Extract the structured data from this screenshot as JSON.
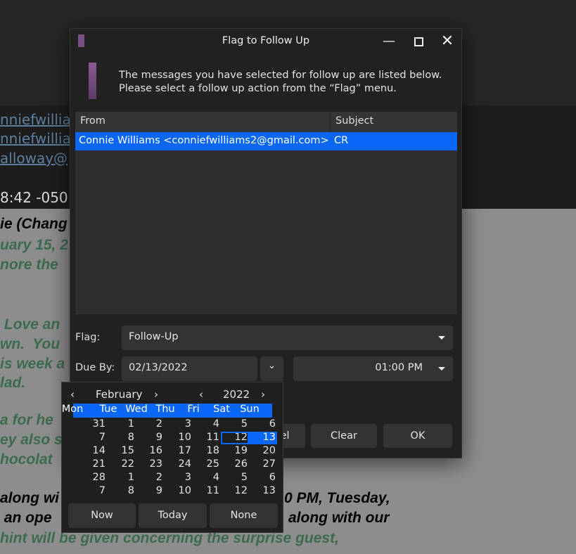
{
  "background": {
    "links": [
      "nniefwillia",
      "nniefwillia",
      "alloway@"
    ],
    "date_fragment": "8:42 -050",
    "lines": [
      {
        "left": "ie (Chang",
        "right": "",
        "style": "black"
      },
      {
        "left": "uary 15, 2",
        "right": "",
        "style": "green"
      },
      {
        "left": "nore the",
        "right": "",
        "style": "green"
      },
      {
        "left": " Love an",
        "right": "",
        "style": "green"
      },
      {
        "left": "wn.  You",
        "right": "",
        "style": "green"
      },
      {
        "left": "is week a",
        "right": "",
        "style": "green"
      },
      {
        "left": "lad.",
        "right": "",
        "style": "green"
      },
      {
        "left": "a for he",
        "right": "",
        "style": "green"
      },
      {
        "left": "ey also s",
        "right": "",
        "style": "green"
      },
      {
        "left": "hocolat",
        "right": "",
        "style": "green"
      },
      {
        "left": "along wi",
        "right": "0 PM, Tuesday,",
        "style": "black"
      },
      {
        "left": " an ope",
        "right": "along with our",
        "style": "black"
      },
      {
        "left": "hint will be given concerning the surprise guest,",
        "right": "",
        "style": "green"
      }
    ]
  },
  "dialog": {
    "title": "Flag to Follow Up",
    "message_line1": "The messages you have selected for follow up are listed below.",
    "message_line2": "Please select a follow up action from the “Flag” menu.",
    "columns": [
      "From",
      "Subject"
    ],
    "rows": [
      {
        "from": "Connie Williams <conniefwilliams2@gmail.com>",
        "subject": "CR"
      }
    ],
    "flag_label": "Flag:",
    "flag_value": "Follow-Up",
    "due_label": "Due By:",
    "due_date": "02/13/2022",
    "due_time": "01:00 PM",
    "buttons": {
      "cancel": "Cancel",
      "clear": "Clear",
      "ok": "OK"
    },
    "accent": "#0a66f5"
  },
  "calendar": {
    "month": "February",
    "year": "2022",
    "weekdays": [
      "Mon",
      "Tue",
      "Wed",
      "Thu",
      "Fri",
      "Sat",
      "Sun"
    ],
    "weeks": [
      [
        "31",
        "1",
        "2",
        "3",
        "4",
        "5",
        "6"
      ],
      [
        "7",
        "8",
        "9",
        "10",
        "11",
        "12",
        "13"
      ],
      [
        "14",
        "15",
        "16",
        "17",
        "18",
        "19",
        "20"
      ],
      [
        "21",
        "22",
        "23",
        "24",
        "25",
        "26",
        "27"
      ],
      [
        "28",
        "1",
        "2",
        "3",
        "4",
        "5",
        "6"
      ],
      [
        "7",
        "8",
        "9",
        "10",
        "11",
        "12",
        "13"
      ]
    ],
    "selected": "13",
    "focused": "12",
    "buttons": {
      "now": "Now",
      "today": "Today",
      "none": "None"
    }
  }
}
